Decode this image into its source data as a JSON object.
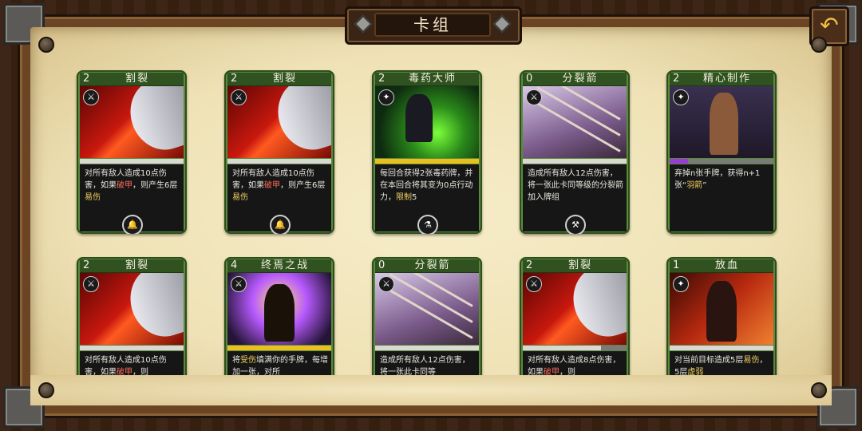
{
  "header": {
    "title": "卡组",
    "back_icon": "undo-arrow-icon"
  },
  "cards": [
    {
      "cost": "2",
      "name": "割裂",
      "type_icon": "sword-icon",
      "bar_fill": 1.0,
      "desc_parts": [
        {
          "t": "对所有敌人造成10点伤害，如果"
        },
        {
          "t": "破甲",
          "c": "kw-red"
        },
        {
          "t": "，则产生6层"
        },
        {
          "t": "易伤",
          "c": "kw"
        }
      ],
      "badge_icon": "bell-icon"
    },
    {
      "cost": "2",
      "name": "割裂",
      "type_icon": "sword-icon",
      "bar_fill": 1.0,
      "desc_parts": [
        {
          "t": "对所有敌人造成10点伤害，如果"
        },
        {
          "t": "破甲",
          "c": "kw-red"
        },
        {
          "t": "，则产生6层"
        },
        {
          "t": "易伤",
          "c": "kw"
        }
      ],
      "badge_icon": "bell-icon"
    },
    {
      "cost": "2",
      "name": "毒药大师",
      "type_icon": "star-icon",
      "bar_fill": 1.0,
      "desc_parts": [
        {
          "t": "每回合获得2张毒药牌，并在本回合将其变为0点行动力，"
        },
        {
          "t": "限制",
          "c": "kw"
        },
        {
          "t": "5"
        }
      ],
      "badge_icon": "potion-icon"
    },
    {
      "cost": "0",
      "name": "分裂箭",
      "type_icon": "sword-icon",
      "bar_fill": 1.0,
      "desc_parts": [
        {
          "t": "造成所有敌人12点伤害，将一张此卡同等级的分裂箭加入牌组"
        }
      ],
      "badge_icon": "crossed-axes-icon"
    },
    {
      "cost": "2",
      "name": "精心制作",
      "type_icon": "star-icon",
      "bar_fill": 0.18,
      "desc_parts": [
        {
          "t": "弃掉n张手牌，获得n+1张“"
        },
        {
          "t": "羽箭",
          "c": "kw"
        },
        {
          "t": "”"
        }
      ],
      "badge_icon": ""
    },
    {
      "cost": "2",
      "name": "割裂",
      "type_icon": "sword-icon",
      "bar_fill": 1.0,
      "desc_parts": [
        {
          "t": "对所有敌人造成10点伤害，如果"
        },
        {
          "t": "破甲",
          "c": "kw-red"
        },
        {
          "t": "，则"
        }
      ],
      "badge_icon": ""
    },
    {
      "cost": "4",
      "name": "终焉之战",
      "type_icon": "sword-icon",
      "bar_fill": 1.0,
      "desc_parts": [
        {
          "t": "将"
        },
        {
          "t": "受伤",
          "c": "kw"
        },
        {
          "t": "填满你的手牌，每增加一张，对所"
        }
      ],
      "badge_icon": ""
    },
    {
      "cost": "0",
      "name": "分裂箭",
      "type_icon": "sword-icon",
      "bar_fill": 1.0,
      "desc_parts": [
        {
          "t": "造成所有敌人12点伤害，将一张此卡同等"
        }
      ],
      "badge_icon": ""
    },
    {
      "cost": "2",
      "name": "割裂",
      "type_icon": "sword-icon",
      "bar_fill": 0.75,
      "desc_parts": [
        {
          "t": "对所有敌人造成8点伤害，如果"
        },
        {
          "t": "破甲",
          "c": "kw-red"
        },
        {
          "t": "，则"
        }
      ],
      "badge_icon": ""
    },
    {
      "cost": "1",
      "name": "放血",
      "type_icon": "star-icon",
      "bar_fill": 1.0,
      "desc_parts": [
        {
          "t": "对当前目标造成5层"
        },
        {
          "t": "易伤",
          "c": "kw"
        },
        {
          "t": "，5层"
        },
        {
          "t": "虚弱",
          "c": "kw"
        }
      ],
      "badge_icon": ""
    }
  ],
  "art_styles": {
    "rend": {
      "bg": "#8a0c08"
    },
    "poison": {
      "bg": "#1e3a18"
    },
    "arrows": {
      "bg": "#5a4a62"
    },
    "craft": {
      "bg": "#2c2440"
    },
    "finale": {
      "bg": "#3a2a5a"
    },
    "bleed": {
      "bg": "#5a1208"
    }
  }
}
